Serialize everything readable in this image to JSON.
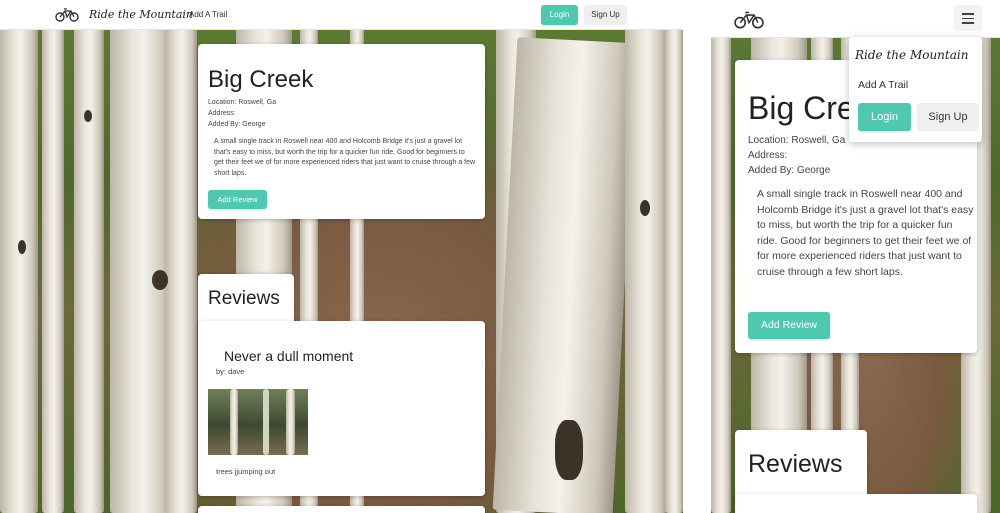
{
  "brand": "Ride the Mountain",
  "nav": {
    "add_trail": "Add A Trail",
    "login": "Login",
    "signup": "Sign Up"
  },
  "trail": {
    "name": "Big Creek",
    "location": "Location: Roswell, Ga",
    "address": "Address:",
    "added_by": "Added By: George",
    "description": "A small single track in Roswell near 400 and Holcomb Bridge it's just a gravel lot that's easy to miss, but worth the trip for a quicker fun ride. Good for beginners to get their feet we of for more experienced riders that just want to cruise through a few short laps.",
    "add_review": "Add Review"
  },
  "reviews": {
    "heading": "Reviews",
    "items": [
      {
        "title": "Never a dull moment",
        "author": "by: dave",
        "caption": "trees jjumping out"
      }
    ]
  },
  "icons": {
    "logo": "bicycle-icon",
    "menu": "hamburger-menu-icon"
  },
  "colors": {
    "accent": "#4ec9b0",
    "secondary_button": "#efefef"
  }
}
